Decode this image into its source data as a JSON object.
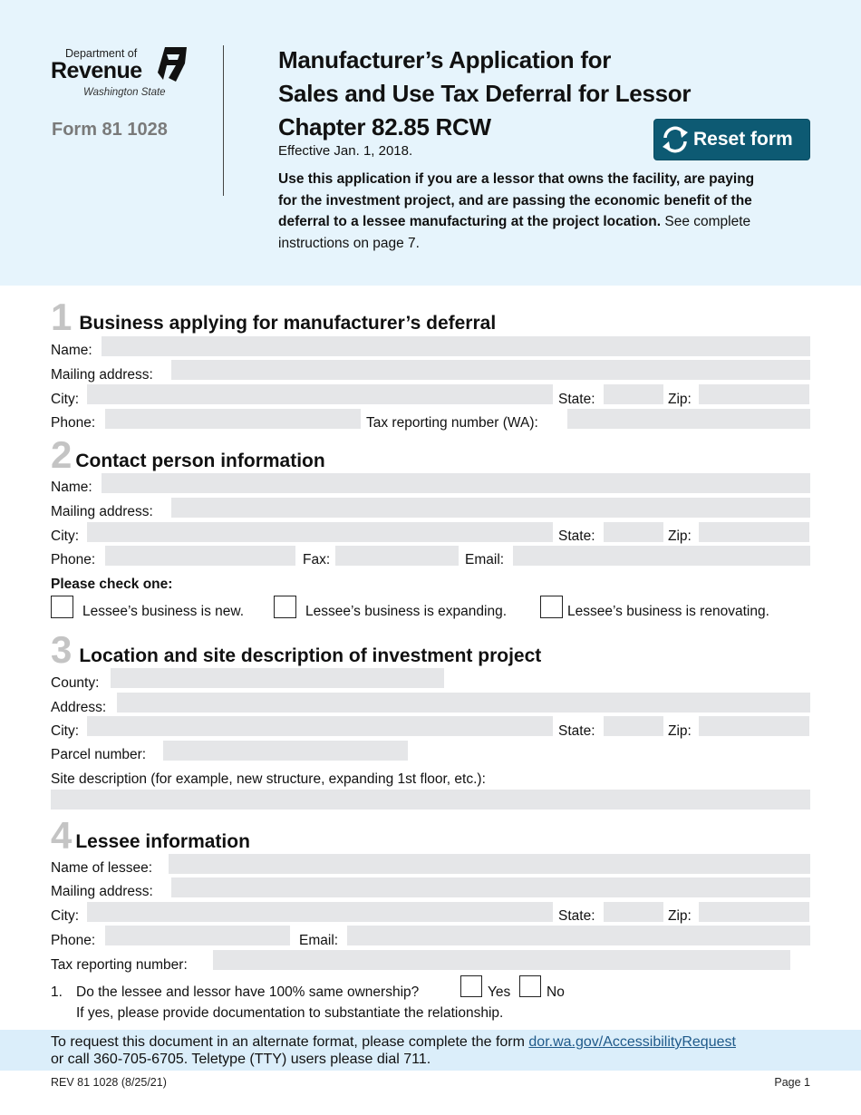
{
  "header": {
    "logo": {
      "line1": "Department of",
      "line2": "Revenue",
      "line3": "Washington State"
    },
    "form_number": "Form 81 1028",
    "title_lines": [
      "Manufacturer’s Application for",
      "Sales and Use Tax Deferral for Lessor",
      "Chapter 82.85 RCW"
    ],
    "effective": "Effective Jan. 1, 2018.",
    "intro_bold": "Use this application if you are a lessor that owns the facility, are paying for the investment project, and are passing the economic benefit of the deferral to a lessee manufacturing at the project location.",
    "intro_rest": " See complete instructions on page 7.",
    "reset_button": "Reset form",
    "reset_icon": "refresh-icon"
  },
  "section1": {
    "number": "1",
    "title": "Business applying for manufacturer’s deferral",
    "labels": {
      "name": "Name:",
      "mailing": "Mailing address:",
      "city": "City:",
      "state": "State:",
      "zip": "Zip:",
      "phone": "Phone:",
      "tax": "Tax reporting number (WA):"
    },
    "values": {
      "name": "",
      "mailing": "",
      "city": "",
      "state": "",
      "zip": "",
      "phone": "",
      "tax": ""
    }
  },
  "section2": {
    "number": "2",
    "title": "Contact person information",
    "labels": {
      "name": "Name:",
      "mailing": "Mailing address:",
      "city": "City:",
      "state": "State:",
      "zip": "Zip:",
      "phone": "Phone:",
      "fax": "Fax:",
      "email": "Email:"
    },
    "values": {
      "name": "",
      "mailing": "",
      "city": "",
      "state": "",
      "zip": "",
      "phone": "",
      "fax": "",
      "email": ""
    },
    "check_heading": "Please check one:",
    "options": [
      {
        "label": "Lessee’s business is new.",
        "checked": false
      },
      {
        "label": "Lessee’s business is expanding.",
        "checked": false
      },
      {
        "label": "Lessee’s business is renovating.",
        "checked": false
      }
    ]
  },
  "section3": {
    "number": "3",
    "title": "Location and site description of investment project",
    "labels": {
      "county": "County:",
      "address": "Address:",
      "city": "City:",
      "state": "State:",
      "zip": "Zip:",
      "parcel": "Parcel number:",
      "site": "Site description (for example, new structure, expanding 1st floor, etc.):"
    },
    "values": {
      "county": "",
      "address": "",
      "city": "",
      "state": "",
      "zip": "",
      "parcel": "",
      "site": ""
    }
  },
  "section4": {
    "number": "4",
    "title": "Lessee information",
    "labels": {
      "name": "Name of lessee:",
      "mailing": "Mailing address:",
      "city": "City:",
      "state": "State:",
      "zip": "Zip:",
      "phone": "Phone:",
      "email": "Email:",
      "tax": "Tax reporting number:"
    },
    "values": {
      "name": "",
      "mailing": "",
      "city": "",
      "state": "",
      "zip": "",
      "phone": "",
      "email": "",
      "tax": ""
    },
    "question_number": "1.",
    "question": "Do the lessee and lessor have 100% same ownership?",
    "yes": "Yes",
    "no": "No",
    "note": "If yes, please provide documentation to substantiate the relationship."
  },
  "footer": {
    "text_before_link": "To request this document in an alternate format, please complete the form ",
    "link": "dor.wa.gov/AccessibilityRequest",
    "text_after": "or call 360-705-6705. Teletype (TTY) users please dial 711.",
    "rev_code": "REV 81 1028  (8/25/21)",
    "page": "Page 1"
  }
}
